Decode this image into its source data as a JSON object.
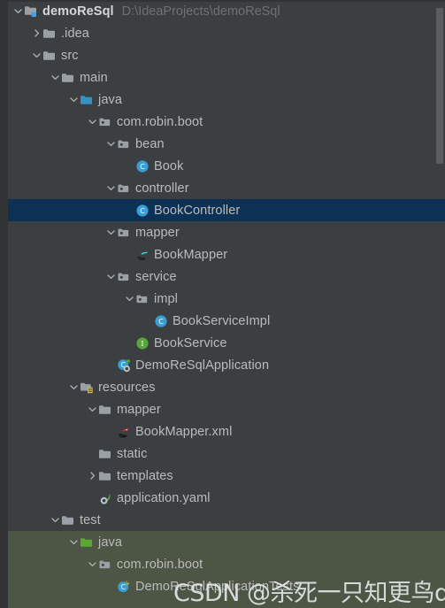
{
  "panel": {
    "name": "project-tool-window",
    "background": "#3c3f41",
    "selection_color": "#0d3055",
    "test_source_root_color": "#4d5645",
    "text_color": "#bbbbbb",
    "muted_text_color": "#6e7173"
  },
  "watermark": {
    "text": "CSDN @杀死一只知更鸟debug"
  },
  "scrollbar": {
    "name": "vertical-scrollbar",
    "thumb_color": "#5a5d5e"
  },
  "tree": {
    "rows": [
      {
        "label": "demoReSql",
        "path_hint": "D:\\IdeaProjects\\demoReSql",
        "depth": 0,
        "twisty": "expanded",
        "icon": "module-folder-icon",
        "bold": true,
        "selected": false,
        "test_scope": false
      },
      {
        "label": ".idea",
        "path_hint": "",
        "depth": 1,
        "twisty": "collapsed",
        "icon": "folder-icon",
        "bold": false,
        "selected": false,
        "test_scope": false
      },
      {
        "label": "src",
        "path_hint": "",
        "depth": 1,
        "twisty": "expanded",
        "icon": "folder-icon",
        "bold": false,
        "selected": false,
        "test_scope": false
      },
      {
        "label": "main",
        "path_hint": "",
        "depth": 2,
        "twisty": "expanded",
        "icon": "folder-icon",
        "bold": false,
        "selected": false,
        "test_scope": false
      },
      {
        "label": "java",
        "path_hint": "",
        "depth": 3,
        "twisty": "expanded",
        "icon": "source-root-folder-icon",
        "bold": false,
        "selected": false,
        "test_scope": false
      },
      {
        "label": "com.robin.boot",
        "path_hint": "",
        "depth": 4,
        "twisty": "expanded",
        "icon": "package-icon",
        "bold": false,
        "selected": false,
        "test_scope": false
      },
      {
        "label": "bean",
        "path_hint": "",
        "depth": 5,
        "twisty": "expanded",
        "icon": "package-icon",
        "bold": false,
        "selected": false,
        "test_scope": false
      },
      {
        "label": "Book",
        "path_hint": "",
        "depth": 6,
        "twisty": "none",
        "icon": "java-class-icon",
        "bold": false,
        "selected": false,
        "test_scope": false
      },
      {
        "label": "controller",
        "path_hint": "",
        "depth": 5,
        "twisty": "expanded",
        "icon": "package-icon",
        "bold": false,
        "selected": false,
        "test_scope": false
      },
      {
        "label": "BookController",
        "path_hint": "",
        "depth": 6,
        "twisty": "none",
        "icon": "java-class-icon",
        "bold": false,
        "selected": true,
        "test_scope": false
      },
      {
        "label": "mapper",
        "path_hint": "",
        "depth": 5,
        "twisty": "expanded",
        "icon": "package-icon",
        "bold": false,
        "selected": false,
        "test_scope": false
      },
      {
        "label": "BookMapper",
        "path_hint": "",
        "depth": 6,
        "twisty": "none",
        "icon": "mybatis-mapper-interface-icon",
        "bold": false,
        "selected": false,
        "test_scope": false
      },
      {
        "label": "service",
        "path_hint": "",
        "depth": 5,
        "twisty": "expanded",
        "icon": "package-icon",
        "bold": false,
        "selected": false,
        "test_scope": false
      },
      {
        "label": "impl",
        "path_hint": "",
        "depth": 6,
        "twisty": "expanded",
        "icon": "package-icon",
        "bold": false,
        "selected": false,
        "test_scope": false
      },
      {
        "label": "BookServiceImpl",
        "path_hint": "",
        "depth": 7,
        "twisty": "none",
        "icon": "java-class-icon",
        "bold": false,
        "selected": false,
        "test_scope": false
      },
      {
        "label": "BookService",
        "path_hint": "",
        "depth": 6,
        "twisty": "none",
        "icon": "java-interface-icon",
        "bold": false,
        "selected": false,
        "test_scope": false
      },
      {
        "label": "DemoReSqlApplication",
        "path_hint": "",
        "depth": 5,
        "twisty": "none",
        "icon": "spring-boot-application-icon",
        "bold": false,
        "selected": false,
        "test_scope": false
      },
      {
        "label": "resources",
        "path_hint": "",
        "depth": 3,
        "twisty": "expanded",
        "icon": "resource-root-folder-icon",
        "bold": false,
        "selected": false,
        "test_scope": false
      },
      {
        "label": "mapper",
        "path_hint": "",
        "depth": 4,
        "twisty": "expanded",
        "icon": "folder-icon",
        "bold": false,
        "selected": false,
        "test_scope": false
      },
      {
        "label": "BookMapper.xml",
        "path_hint": "",
        "depth": 5,
        "twisty": "none",
        "icon": "mybatis-xml-icon",
        "bold": false,
        "selected": false,
        "test_scope": false
      },
      {
        "label": "static",
        "path_hint": "",
        "depth": 4,
        "twisty": "none",
        "icon": "folder-icon",
        "bold": false,
        "selected": false,
        "test_scope": false
      },
      {
        "label": "templates",
        "path_hint": "",
        "depth": 4,
        "twisty": "collapsed",
        "icon": "folder-icon",
        "bold": false,
        "selected": false,
        "test_scope": false
      },
      {
        "label": "application.yaml",
        "path_hint": "",
        "depth": 4,
        "twisty": "none",
        "icon": "spring-config-yaml-icon",
        "bold": false,
        "selected": false,
        "test_scope": false
      },
      {
        "label": "test",
        "path_hint": "",
        "depth": 2,
        "twisty": "expanded",
        "icon": "folder-icon",
        "bold": false,
        "selected": false,
        "test_scope": false
      },
      {
        "label": "java",
        "path_hint": "",
        "depth": 3,
        "twisty": "expanded",
        "icon": "test-source-root-folder-icon",
        "bold": false,
        "selected": false,
        "test_scope": true
      },
      {
        "label": "com.robin.boot",
        "path_hint": "",
        "depth": 4,
        "twisty": "expanded",
        "icon": "package-icon",
        "bold": false,
        "selected": false,
        "test_scope": true
      },
      {
        "label": "DemoReSqlApplicationTests",
        "path_hint": "",
        "depth": 5,
        "twisty": "none",
        "icon": "test-class-icon",
        "bold": false,
        "selected": false,
        "test_scope": true
      }
    ]
  }
}
